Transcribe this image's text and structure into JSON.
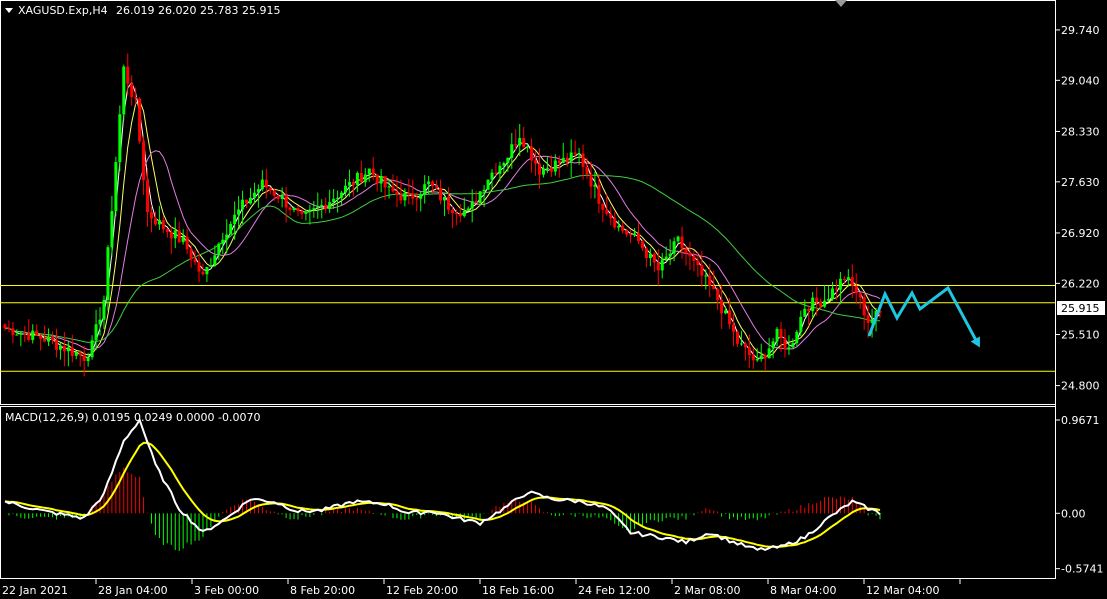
{
  "header": {
    "symbol": "XAGUSD.Exp,H4",
    "ohlc": "26.019 26.020 25.783 25.915"
  },
  "macd": {
    "label": "MACD(12,26,9) 0.0195 0.0249 0.0000 -0.0070",
    "ticks": [
      "0.9671",
      "0.00",
      "-0.5741"
    ]
  },
  "colors": {
    "background": "#000000",
    "bull": "#00ff00",
    "bear": "#ff0000",
    "level": "#ffff00",
    "forecast": "#1fc6e0",
    "ma_fast": "#ffffff",
    "ma_mid": "#ffff66",
    "ma_slow": "#e27ee2",
    "ma_long": "#3ecf3e",
    "macd_line": "#ffffff",
    "macd_signal": "#ffff00"
  },
  "chart_data": {
    "type": "candlestick",
    "price_axis": {
      "range": [
        24.6,
        30.1
      ],
      "ticks": [
        "29.740",
        "29.040",
        "28.330",
        "27.630",
        "26.920",
        "26.220",
        "25.510",
        "24.800"
      ]
    },
    "current_price": "25.915",
    "horizontal_levels": [
      26.19,
      25.95,
      25.0
    ],
    "x_axis_labels": [
      "22 Jan 2021",
      "28 Jan 04:00",
      "3 Feb 00:00",
      "8 Feb 20:00",
      "12 Feb 20:00",
      "18 Feb 16:00",
      "24 Feb 12:00",
      "2 Mar 08:00",
      "8 Mar 04:00",
      "12 Mar 04:00"
    ],
    "close_anchors": [
      [
        0,
        25.6
      ],
      [
        10,
        25.45
      ],
      [
        20,
        25.2
      ],
      [
        22,
        25.35
      ],
      [
        25,
        26.0
      ],
      [
        30,
        29.2
      ],
      [
        33,
        28.7
      ],
      [
        36,
        27.2
      ],
      [
        40,
        27.0
      ],
      [
        45,
        26.8
      ],
      [
        50,
        26.3
      ],
      [
        55,
        26.9
      ],
      [
        60,
        27.3
      ],
      [
        65,
        27.6
      ],
      [
        70,
        27.4
      ],
      [
        75,
        27.1
      ],
      [
        80,
        27.3
      ],
      [
        85,
        27.5
      ],
      [
        92,
        27.8
      ],
      [
        97,
        27.5
      ],
      [
        102,
        27.4
      ],
      [
        107,
        27.6
      ],
      [
        112,
        27.3
      ],
      [
        117,
        27.2
      ],
      [
        122,
        27.7
      ],
      [
        127,
        28.0
      ],
      [
        130,
        28.3
      ],
      [
        135,
        27.8
      ],
      [
        140,
        27.9
      ],
      [
        145,
        28.0
      ],
      [
        150,
        27.4
      ],
      [
        155,
        27.0
      ],
      [
        160,
        26.8
      ],
      [
        165,
        26.4
      ],
      [
        170,
        26.8
      ],
      [
        175,
        26.4
      ],
      [
        180,
        26.0
      ],
      [
        185,
        25.4
      ],
      [
        190,
        25.1
      ],
      [
        195,
        25.5
      ],
      [
        198,
        25.3
      ],
      [
        202,
        25.9
      ],
      [
        207,
        26.0
      ],
      [
        212,
        26.3
      ],
      [
        215,
        26.1
      ],
      [
        218,
        25.7
      ],
      [
        221,
        25.8
      ]
    ],
    "forecast_path": [
      [
        869,
        336
      ],
      [
        885,
        294
      ],
      [
        897,
        318
      ],
      [
        912,
        293
      ],
      [
        920,
        309
      ],
      [
        948,
        288
      ],
      [
        978,
        344
      ]
    ],
    "macd_anchors": [
      [
        0,
        0.12
      ],
      [
        10,
        0.02
      ],
      [
        20,
        -0.05
      ],
      [
        25,
        0.2
      ],
      [
        30,
        0.75
      ],
      [
        34,
        0.97
      ],
      [
        38,
        0.5
      ],
      [
        44,
        0.05
      ],
      [
        50,
        -0.2
      ],
      [
        56,
        -0.05
      ],
      [
        62,
        0.15
      ],
      [
        68,
        0.12
      ],
      [
        74,
        0.02
      ],
      [
        80,
        0.03
      ],
      [
        88,
        0.12
      ],
      [
        96,
        0.1
      ],
      [
        102,
        0.0
      ],
      [
        108,
        0.02
      ],
      [
        114,
        -0.05
      ],
      [
        120,
        -0.1
      ],
      [
        126,
        0.05
      ],
      [
        132,
        0.22
      ],
      [
        138,
        0.15
      ],
      [
        146,
        0.12
      ],
      [
        152,
        0.05
      ],
      [
        158,
        -0.2
      ],
      [
        166,
        -0.25
      ],
      [
        172,
        -0.3
      ],
      [
        178,
        -0.2
      ],
      [
        184,
        -0.3
      ],
      [
        190,
        -0.38
      ],
      [
        196,
        -0.35
      ],
      [
        202,
        -0.25
      ],
      [
        208,
        -0.05
      ],
      [
        214,
        0.12
      ],
      [
        218,
        0.05
      ],
      [
        221,
        0.0
      ]
    ],
    "macd_axis": {
      "range": [
        -0.65,
        1.05
      ]
    }
  }
}
